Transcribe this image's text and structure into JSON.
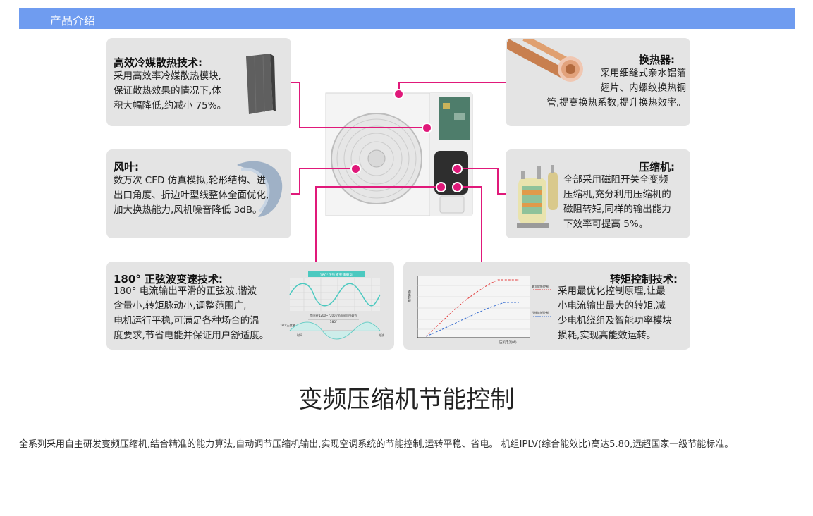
{
  "header": {
    "title": "产品介绍"
  },
  "cards": {
    "heat_dissipation": {
      "title": "高效冷媒散热技术:",
      "lines": [
        "采用高效率冷媒散热模块,",
        "保证散热效果的情况下,体",
        "积大幅降低,约减小 75%。"
      ]
    },
    "fan": {
      "title": "风叶:",
      "lines": [
        "数万次 CFD 仿真模拟,轮形结构、进",
        "出口角度、折边叶型线整体全面优化,",
        "加大换热能力,风机噪音降低 3dB。"
      ]
    },
    "sine_wave": {
      "title": "180° 正弦波变速技术:",
      "lines": [
        "180° 电流输出平滑的正弦波,谐波",
        "含量小,转矩脉动小,调整范围广,",
        "电机运行平稳,可满足各种场合的温",
        "度要求,节省电能并保证用户舒适度。"
      ],
      "chart": {
        "banner": "180°正弦波变速驱动",
        "band_label": "频率在1200~7200r/min间自由调节",
        "deg_label": "180°",
        "axis_left": "180°正弦波",
        "axis_time": "时间",
        "axis_current": "电流"
      }
    },
    "heat_exchanger": {
      "title": "换热器:",
      "lines": [
        "采用细缝式亲水铝箔",
        "翅片、内螺纹换热铜",
        "管,提高换热系数,提升换热效率。"
      ]
    },
    "compressor": {
      "title": "压缩机:",
      "lines": [
        "全部采用磁阻开关全变频",
        "压缩机,充分利用压缩机的",
        "磁阻转矩,同样的输出能力",
        "下效率可提高 5%。"
      ]
    },
    "torque": {
      "title": "转矩控制技术:",
      "lines": [
        "采用最优化控制原理,让最",
        "小电流输出最大的转矩,减",
        "少电机绕组及智能功率模块",
        "损耗,实现高能效运转。"
      ],
      "chart": {
        "ylabel": "输出转矩",
        "xlabel": "压机电流(A)",
        "max_label": "最大转矩控制",
        "trad_label": "传统转矩控制"
      }
    }
  },
  "section": {
    "title": "变频压缩机节能控制",
    "description": "全系列采用自主研发变频压缩机,结合精准的能力算法,自动调节压缩机输出,实现空调系统的节能控制,运转平稳、省电。 机组IPLV(综合能效比)高达5.80,远超国家一级节能标准。"
  },
  "colors": {
    "header": "#6f9cf0",
    "accent": "#e0197a",
    "card": "#e4e4e4"
  }
}
